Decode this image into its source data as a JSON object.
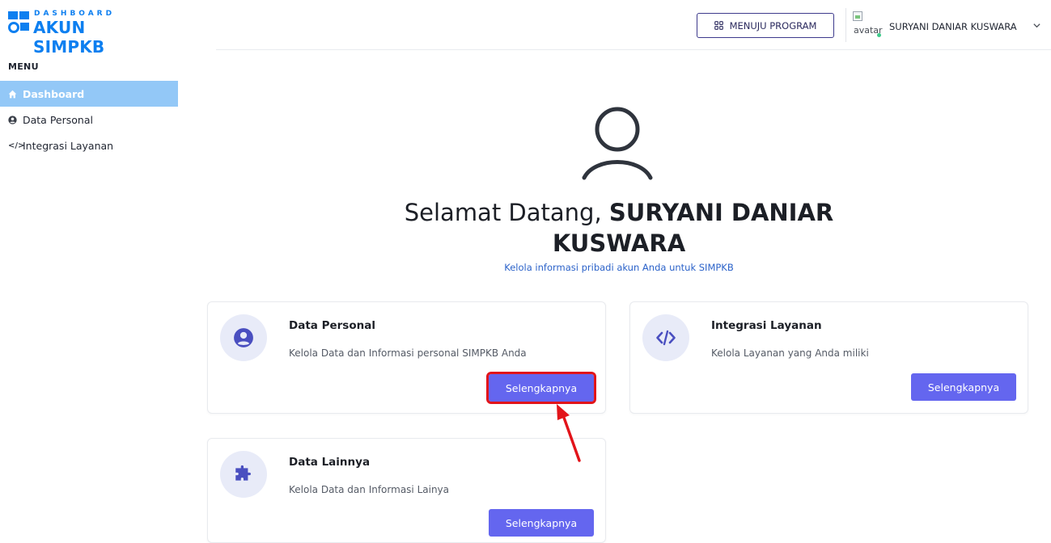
{
  "logo": {
    "small": "DASHBOARD",
    "big": "AKUN SIMPKB"
  },
  "sidebar": {
    "menu_title": "MENU",
    "items": [
      {
        "label": "Dashboard",
        "icon": "home-icon",
        "active": true
      },
      {
        "label": "Data Personal",
        "icon": "user-circle-icon",
        "active": false
      },
      {
        "label": "Integrasi Layanan",
        "icon": "code-icon",
        "active": false
      }
    ]
  },
  "topbar": {
    "program_button": "MENUJU PROGRAM",
    "program_icon": "grid-icon",
    "avatar_alt": "avatar",
    "user_name": "SURYANI DANIAR KUSWARA",
    "dropdown_icon": "chevron-down-icon"
  },
  "hero": {
    "icon": "user-outline-icon",
    "greeting": "Selamat Datang, ",
    "name": "SURYANI DANIAR KUSWARA",
    "subtitle": "Kelola informasi pribadi akun Anda untuk SIMPKB"
  },
  "cards": [
    {
      "title": "Data Personal",
      "description": "Kelola Data dan Informasi personal SIMPKB Anda",
      "button": "Selengkapnya",
      "icon": "user-circle-icon"
    },
    {
      "title": "Integrasi Layanan",
      "description": "Kelola Layanan yang Anda miliki",
      "button": "Selengkapnya",
      "icon": "code-icon"
    },
    {
      "title": "Data Lainnya",
      "description": "Kelola Data dan Informasi Lainya",
      "button": "Selengkapnya",
      "icon": "puzzle-icon"
    }
  ],
  "colors": {
    "brand": "#0d7ff0",
    "sidebar_active": "#93c8f7",
    "button": "#6466ef",
    "icon": "#4a4fc0",
    "highlight": "#e2141a",
    "link": "#2b62c9"
  }
}
